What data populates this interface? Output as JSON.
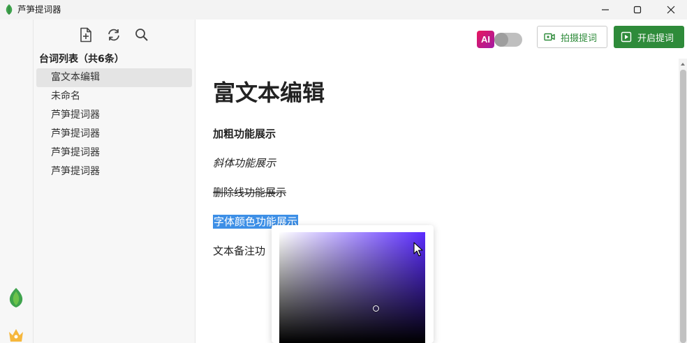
{
  "window": {
    "title": "芦笋提词器",
    "icons": {
      "minimize": "minimize-icon",
      "maximize": "maximize-icon",
      "close": "close-icon"
    }
  },
  "sidebar": {
    "tools": [
      "new-document-icon",
      "refresh-icon",
      "search-icon"
    ],
    "heading": "台词列表（共6条）",
    "items": [
      {
        "label": "富文本编辑",
        "active": true
      },
      {
        "label": "未命名",
        "active": false
      },
      {
        "label": "芦笋提词器",
        "active": false
      },
      {
        "label": "芦笋提词器",
        "active": false
      },
      {
        "label": "芦笋提词器",
        "active": false
      },
      {
        "label": "芦笋提词器",
        "active": false
      }
    ]
  },
  "toolbar": {
    "ai_badge": "AI",
    "ai_toggle_on": false,
    "record_label": "拍摄提词",
    "start_label": "开启提词"
  },
  "document": {
    "title": "富文本编辑",
    "bold_text": "加粗功能展示",
    "italic_text": "斜体功能展示",
    "strike_text": "删除线功能展示",
    "color_text": "字体颜色功能展示",
    "note_text": "文本备注功"
  },
  "color_picker": {
    "hue_color": "#5a2bff",
    "selection_color": "#3d8fe6"
  },
  "colors": {
    "accent_green": "#2e8b3a",
    "ai_gradient_start": "#e8175d",
    "ai_gradient_end": "#a11ba4"
  }
}
